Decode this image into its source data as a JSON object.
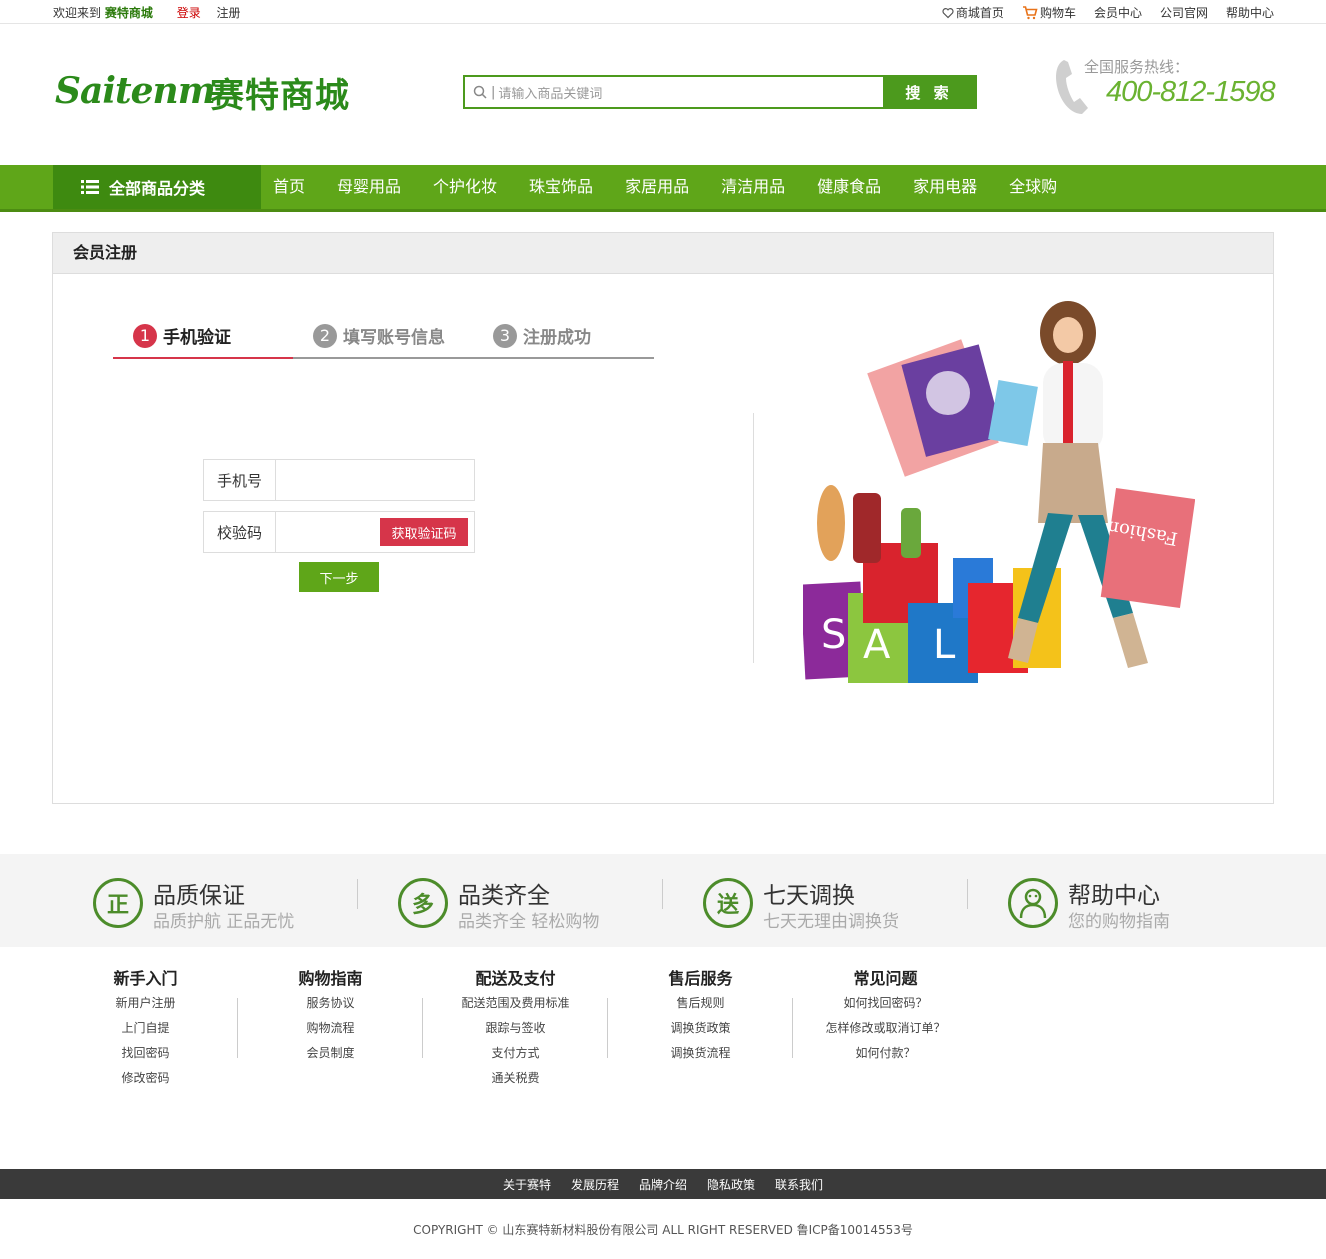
{
  "topbar": {
    "welcome": "欢迎来到",
    "brand": "赛特商城",
    "login": "登录",
    "register": "注册",
    "links": [
      {
        "label": "商城首页",
        "icon": "heart-icon"
      },
      {
        "label": "购物车",
        "icon": "cart-icon"
      },
      {
        "label": "会员中心"
      },
      {
        "label": "公司官网"
      },
      {
        "label": "帮助中心"
      }
    ]
  },
  "header": {
    "logo_script": "Saitenm",
    "logo_cn": "赛特商城",
    "search_placeholder": "请输入商品关键词",
    "search_button": "搜 索",
    "hotline_label": "全国服务热线：",
    "hotline_number": "400-812-1598"
  },
  "nav": {
    "all_categories": "全部商品分类",
    "items": [
      "首页",
      "母婴用品",
      "个护化妆",
      "珠宝饰品",
      "家居用品",
      "清洁用品",
      "健康食品",
      "家用电器",
      "全球购"
    ]
  },
  "register": {
    "title": "会员注册",
    "steps": [
      {
        "num": "1",
        "label": "手机验证",
        "active": true
      },
      {
        "num": "2",
        "label": "填写账号信息",
        "active": false
      },
      {
        "num": "3",
        "label": "注册成功",
        "active": false
      }
    ],
    "phone_label": "手机号",
    "code_label": "校验码",
    "get_code": "获取验证码",
    "next": "下一步",
    "illustration_text": "Fashion",
    "bag_letters": [
      "S",
      "A",
      "L"
    ]
  },
  "services": [
    {
      "icon": "正",
      "title": "品质保证",
      "desc": "品质护航 正品无忧"
    },
    {
      "icon": "多",
      "title": "品类齐全",
      "desc": "品类齐全 轻松购物"
    },
    {
      "icon": "送",
      "title": "七天调换",
      "desc": "七天无理由调换货"
    },
    {
      "icon": "help",
      "title": "帮助中心",
      "desc": "您的购物指南"
    }
  ],
  "footer_columns": [
    {
      "title": "新手入门",
      "items": [
        "新用户注册",
        "上门自提",
        "找回密码",
        "修改密码"
      ]
    },
    {
      "title": "购物指南",
      "items": [
        "服务协议",
        "购物流程",
        "会员制度"
      ]
    },
    {
      "title": "配送及支付",
      "items": [
        "配送范围及费用标准",
        "跟踪与签收",
        "支付方式",
        "通关税费"
      ]
    },
    {
      "title": "售后服务",
      "items": [
        "售后规则",
        "调换货政策",
        "调换货流程"
      ]
    },
    {
      "title": "常见问题",
      "items": [
        "如何找回密码？",
        "怎样修改或取消订单？",
        "如何付款？"
      ]
    }
  ],
  "bottom_links": [
    "关于赛特",
    "发展历程",
    "品牌介绍",
    "隐私政策",
    "联系我们"
  ],
  "copyright": "COPYRIGHT © 山东赛特新材料股份有限公司 ALL RIGHT RESERVED 鲁ICP备10014553号",
  "colors": {
    "primary_green": "#5fa619",
    "dark_green": "#3e8a10",
    "accent_red": "#d6354a"
  }
}
